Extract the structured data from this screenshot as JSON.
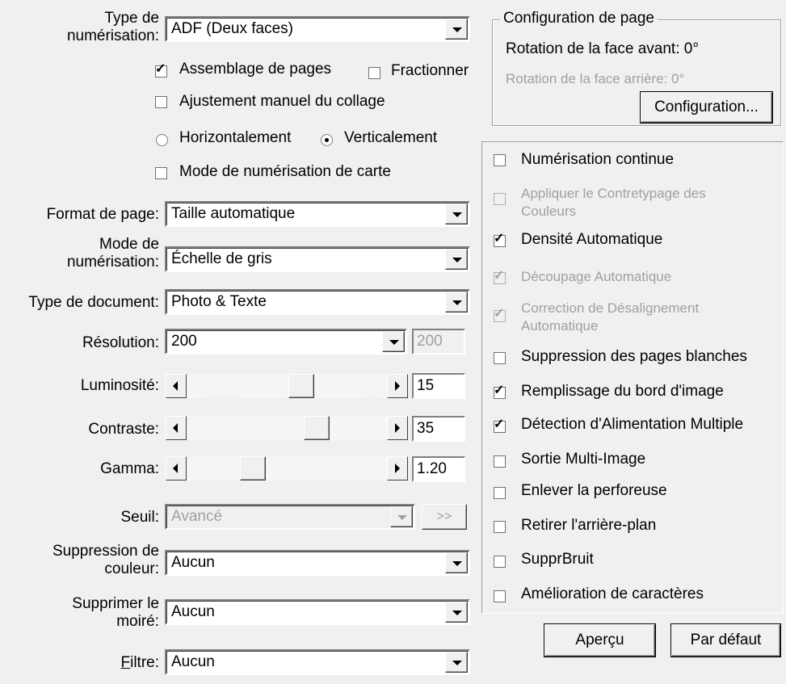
{
  "left": {
    "scan_type": {
      "label_line1": "Type de",
      "label_line2": "numérisation:",
      "value": "ADF (Deux faces)"
    },
    "page_assembly": {
      "label": "Assemblage de pages",
      "checked": true
    },
    "split": {
      "label": "Fractionner",
      "checked": false
    },
    "manual_stitch": {
      "label": "Ajustement manuel du collage",
      "checked": false
    },
    "horizontal": {
      "label": "Horizontalement",
      "selected": false
    },
    "vertical": {
      "label": "Verticalement",
      "selected": true
    },
    "card_scan": {
      "label": "Mode de numérisation de carte",
      "checked": false
    },
    "page_format": {
      "label": "Format de page:",
      "value": "Taille automatique"
    },
    "scan_mode": {
      "label_line1": "Mode de",
      "label_line2": "numérisation:",
      "value": "Échelle de gris"
    },
    "doc_type": {
      "label": "Type de document:",
      "value": "Photo & Texte"
    },
    "resolution": {
      "label": "Résolution:",
      "value": "200",
      "number": "200"
    },
    "brightness": {
      "label": "Luminosité:",
      "value": "15"
    },
    "contrast": {
      "label": "Contraste:",
      "value": "35"
    },
    "gamma": {
      "label": "Gamma:",
      "value": "1.20"
    },
    "threshold": {
      "label": "Seuil:",
      "value": "Avancé",
      "button": ">>"
    },
    "color_drop": {
      "label_line1": "Suppression de",
      "label_line2": "couleur:",
      "value": "Aucun"
    },
    "moire": {
      "label_line1": "Supprimer le",
      "label_line2": "moiré:",
      "value": "Aucun"
    },
    "filter": {
      "label_prefix": "F",
      "label_rest": "iltre:",
      "value": "Aucun"
    }
  },
  "page_config": {
    "title": "Configuration de page",
    "front_rotation": "Rotation de la face avant: 0°",
    "back_rotation": "Rotation de la face arrière: 0°",
    "button": "Configuration..."
  },
  "options": [
    {
      "label": "Numérisation continue",
      "checked": false,
      "enabled": true
    },
    {
      "label": "Appliquer le Contretypage des",
      "label2": "Couleurs",
      "checked": false,
      "enabled": false
    },
    {
      "label": "Densité Automatique",
      "checked": true,
      "enabled": true
    },
    {
      "label": "Découpage Automatique",
      "checked": true,
      "enabled": false
    },
    {
      "label": "Correction de Désalignement",
      "label2": "Automatique",
      "checked": true,
      "enabled": false
    },
    {
      "label": "Suppression des pages blanches",
      "checked": false,
      "enabled": true
    },
    {
      "label": "Remplissage du bord d'image",
      "checked": true,
      "enabled": true
    },
    {
      "label": "Détection d'Alimentation Multiple",
      "checked": true,
      "enabled": true
    },
    {
      "label": "Sortie Multi-Image",
      "checked": false,
      "enabled": true
    },
    {
      "label": "Enlever la perforeuse",
      "checked": false,
      "enabled": true
    },
    {
      "label": "Retirer l'arrière-plan",
      "checked": false,
      "enabled": true
    },
    {
      "label": "SupprBruit",
      "checked": false,
      "enabled": true
    },
    {
      "label": "Amélioration de caractères",
      "checked": false,
      "enabled": true
    }
  ],
  "buttons": {
    "preview": "Aperçu",
    "default": "Par défaut"
  }
}
